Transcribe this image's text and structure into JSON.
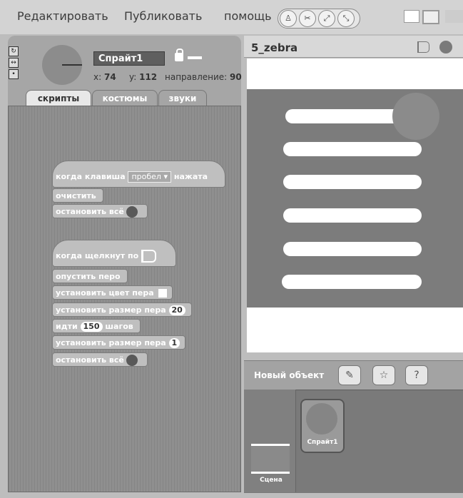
{
  "menu": {
    "edit": "Редактировать",
    "publish": "Публиковать",
    "help": "помощь"
  },
  "toolbar_icons": [
    "person-icon",
    "stamp-icon",
    "grow-icon",
    "shrink-icon"
  ],
  "sprite": {
    "name": "Спрайт1",
    "x_label": "x:",
    "x_value": "74",
    "y_label": "y:",
    "y_value": "112",
    "direction_label": "направление:",
    "direction_value": "90"
  },
  "tabs": [
    "скрипты",
    "костюмы",
    "звуки"
  ],
  "scripts": {
    "script1": {
      "hat": "когда клавиша",
      "key": "пробел",
      "hat_end": "нажата",
      "clear": "очистить",
      "stop": "остановить всё"
    },
    "script2": {
      "hat": "когда щелкнут по",
      "pen_down": "опустить перо",
      "set_color": "установить цвет пера",
      "set_size1": "установить размер пера",
      "size1": "20",
      "move": "идти",
      "steps": "150",
      "steps_unit": "шагов",
      "set_size2": "установить размер пера",
      "size2": "1",
      "stop": "остановить всё"
    }
  },
  "stage": {
    "title": "5_zebra"
  },
  "corral": {
    "new_object": "Новый объект",
    "stage_label": "Сцена",
    "sprite_label": "Спрайт1"
  },
  "colors": {
    "stage_bg": "#7c7c7c",
    "stripe": "#ffffff",
    "block": "#bfbfbf"
  }
}
